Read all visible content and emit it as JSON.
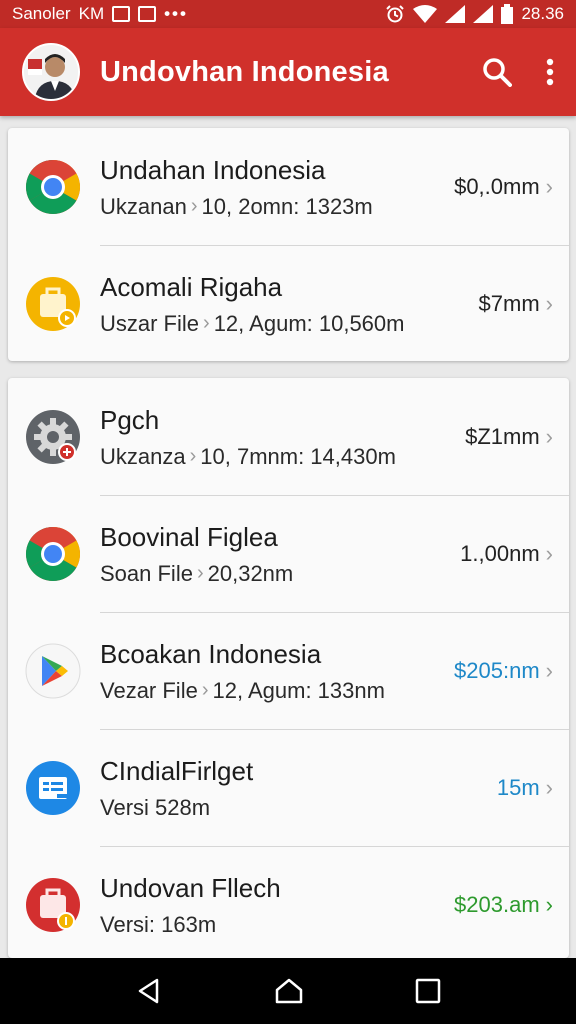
{
  "status_bar": {
    "carrier": "Sanoler",
    "km": "KM",
    "dots": "•••",
    "time": "28.36"
  },
  "app_bar": {
    "title": "Undovhan Indonesia",
    "search_icon": "search-icon",
    "menu_icon": "more-vert-icon"
  },
  "colors": {
    "app_bar": "#d0302b",
    "status_bar": "#bf2b26",
    "value_blue": "#1e88c8",
    "value_green": "#2e9a2e"
  },
  "cards": [
    {
      "items": [
        {
          "icon": "chrome-icon",
          "title": "Undahan Indonesia",
          "sub_a": "Ukzanan",
          "sub_b": "10, 2omn: 1323m",
          "value": "$0,.0mm",
          "value_color": ""
        },
        {
          "icon": "briefcase-icon",
          "title": "Acomali Rigaha",
          "sub_a": "Uszar File",
          "sub_b": "12, Agum: 10,560m",
          "value": "$7mm",
          "value_color": ""
        }
      ]
    },
    {
      "items": [
        {
          "icon": "gear-icon",
          "title": "Pgch",
          "sub_a": "Ukzanza",
          "sub_b": "10, 7mnm: 14,430m",
          "value": "$Z1mm",
          "value_color": ""
        },
        {
          "icon": "chrome-icon",
          "title": "Boovinal Figlea",
          "sub_a": "Soan File",
          "sub_b": "20,32nm",
          "value": "1.,00nm",
          "value_color": ""
        },
        {
          "icon": "play-store-icon",
          "title": "Bcoakan Indonesia",
          "sub_a": "Vezar File",
          "sub_b": "12, Agum: 133nm",
          "value": "$205:nm",
          "value_color": "#1e88c8"
        },
        {
          "icon": "document-icon",
          "title": "CIndialFirlget",
          "sub_a": "Versi 528m",
          "sub_b": "",
          "value": "15m",
          "value_color": "#1e88c8"
        },
        {
          "icon": "briefcase-icon",
          "title": "Undovan Fllech",
          "sub_a": "Versi: 163m",
          "sub_b": "",
          "value": "$203.am",
          "value_color": "#2e9a2e"
        }
      ]
    }
  ],
  "nav": {
    "back_icon": "back-triangle-icon",
    "home_icon": "home-icon",
    "recents_icon": "recents-square-icon"
  }
}
